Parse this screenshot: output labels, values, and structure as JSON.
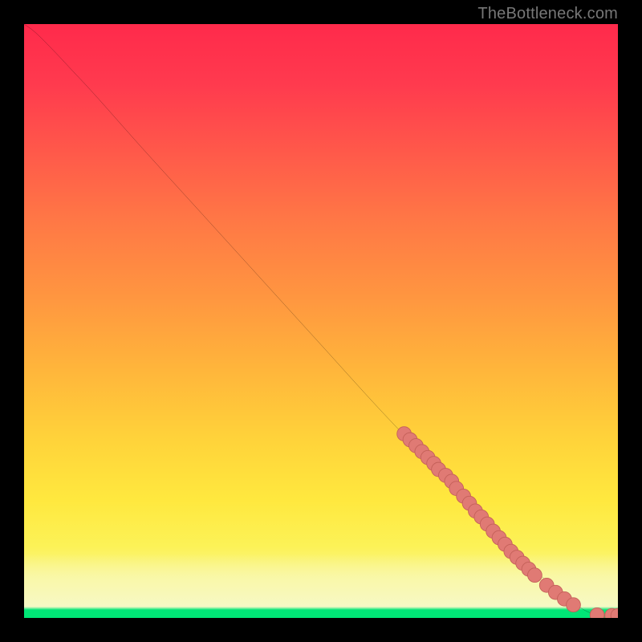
{
  "attribution": "TheBottleneck.com",
  "colors": {
    "background": "#000000",
    "gradient_top": "#ff2a4b",
    "gradient_mid": "#ffd33a",
    "gradient_low": "#f9f696",
    "gradient_bottom_band": "#f6f9c8",
    "green_strip": "#00e676",
    "curve_stroke": "#000000",
    "marker_fill": "#e07a74",
    "marker_stroke": "#c46059"
  },
  "chart_data": {
    "type": "line",
    "title": "",
    "xlabel": "",
    "ylabel": "",
    "xlim": [
      0,
      100
    ],
    "ylim": [
      0,
      100
    ],
    "grid": false,
    "legend": false,
    "line": {
      "note": "Monotone decreasing curve from top-left to bottom-right; slight initial convexity then near-linear; flattens to zero at far right.",
      "points": [
        {
          "x": 0,
          "y": 100
        },
        {
          "x": 2,
          "y": 98.5
        },
        {
          "x": 5,
          "y": 95.5
        },
        {
          "x": 8,
          "y": 92.3
        },
        {
          "x": 12,
          "y": 88.0
        },
        {
          "x": 20,
          "y": 79.0
        },
        {
          "x": 30,
          "y": 68.0
        },
        {
          "x": 40,
          "y": 57.0
        },
        {
          "x": 50,
          "y": 46.0
        },
        {
          "x": 60,
          "y": 35.0
        },
        {
          "x": 70,
          "y": 24.5
        },
        {
          "x": 78,
          "y": 16.0
        },
        {
          "x": 85,
          "y": 9.0
        },
        {
          "x": 90,
          "y": 4.5
        },
        {
          "x": 93,
          "y": 2.2
        },
        {
          "x": 95,
          "y": 1.0
        },
        {
          "x": 97,
          "y": 0.4
        },
        {
          "x": 100,
          "y": 0.3
        }
      ]
    },
    "markers": {
      "note": "Salmon-colored dot markers clustered along the lower-right segment of the curve; some overlap producing thicker lozenge segments.",
      "radius_pct": 1.2,
      "points": [
        {
          "x": 64.0,
          "y": 31.0
        },
        {
          "x": 65.0,
          "y": 30.0
        },
        {
          "x": 66.0,
          "y": 29.0
        },
        {
          "x": 67.0,
          "y": 28.0
        },
        {
          "x": 68.0,
          "y": 27.0
        },
        {
          "x": 69.0,
          "y": 26.0
        },
        {
          "x": 69.8,
          "y": 25.0
        },
        {
          "x": 71.0,
          "y": 24.0
        },
        {
          "x": 72.0,
          "y": 23.0
        },
        {
          "x": 72.8,
          "y": 21.8
        },
        {
          "x": 74.0,
          "y": 20.5
        },
        {
          "x": 75.0,
          "y": 19.3
        },
        {
          "x": 76.0,
          "y": 18.0
        },
        {
          "x": 77.0,
          "y": 17.0
        },
        {
          "x": 78.0,
          "y": 15.8
        },
        {
          "x": 79.0,
          "y": 14.6
        },
        {
          "x": 80.0,
          "y": 13.5
        },
        {
          "x": 81.0,
          "y": 12.4
        },
        {
          "x": 82.0,
          "y": 11.2
        },
        {
          "x": 83.0,
          "y": 10.2
        },
        {
          "x": 84.0,
          "y": 9.2
        },
        {
          "x": 85.0,
          "y": 8.2
        },
        {
          "x": 86.0,
          "y": 7.2
        },
        {
          "x": 88.0,
          "y": 5.5
        },
        {
          "x": 89.5,
          "y": 4.3
        },
        {
          "x": 91.0,
          "y": 3.2
        },
        {
          "x": 92.5,
          "y": 2.2
        },
        {
          "x": 96.5,
          "y": 0.5
        },
        {
          "x": 99.0,
          "y": 0.4
        },
        {
          "x": 100.0,
          "y": 0.4
        }
      ]
    }
  }
}
